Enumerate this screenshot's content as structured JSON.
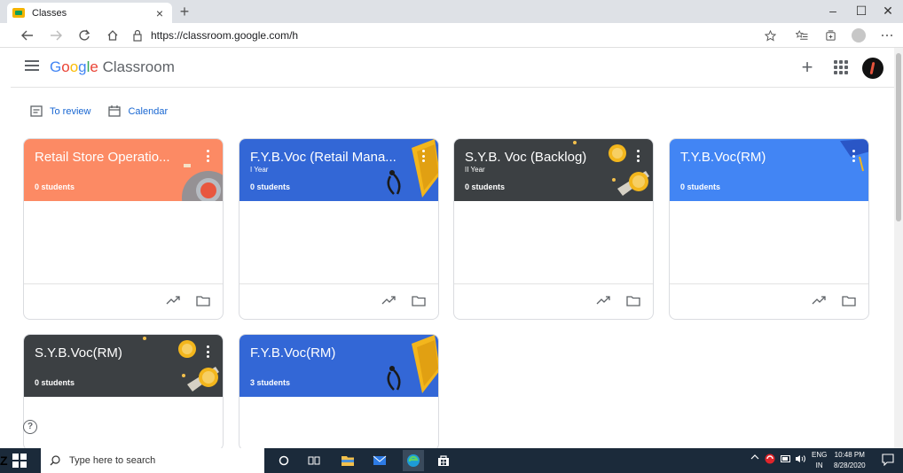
{
  "browser": {
    "tab_title": "Classes",
    "tab_close": "×",
    "new_tab": "+",
    "url": "https://classroom.google.com/h",
    "window_controls": {
      "minimize": "–",
      "maximize": "☐",
      "close": "✕"
    }
  },
  "app": {
    "brand_google": [
      "G",
      "o",
      "o",
      "g",
      "l",
      "e"
    ],
    "brand_product": "Classroom",
    "create_symbol": "+"
  },
  "quick_links": {
    "review": "To review",
    "calendar": "Calendar"
  },
  "classes": [
    {
      "title": "Retail Store Operatio...",
      "section": "",
      "students": "0 students",
      "theme": "orange"
    },
    {
      "title": "F.Y.B.Voc (Retail Mana...",
      "section": "I Year",
      "students": "0 students",
      "theme": "blue"
    },
    {
      "title": "S.Y.B. Voc (Backlog)",
      "section": "II Year",
      "students": "0 students",
      "theme": "dark"
    },
    {
      "title": "T.Y.B.Voc(RM)",
      "section": "",
      "students": "0 students",
      "theme": "sky"
    },
    {
      "title": "S.Y.B.Voc(RM)",
      "section": "",
      "students": "0 students",
      "theme": "dark"
    },
    {
      "title": "F.Y.B.Voc(RM)",
      "section": "",
      "students": "3 students",
      "theme": "blue"
    }
  ],
  "help_symbol": "?",
  "taskbar": {
    "search_placeholder": "Type here to search",
    "language_top": "ENG",
    "language_bottom": "IN",
    "time": "10:48 PM",
    "date": "8/28/2020"
  },
  "edge_char": "Z",
  "colors": {
    "orange": "#fc8a64",
    "blue": "#3367d6",
    "dark": "#3c4043",
    "sky": "#4285f4",
    "link": "#1967d2",
    "taskbar": "#1b2a3a"
  }
}
